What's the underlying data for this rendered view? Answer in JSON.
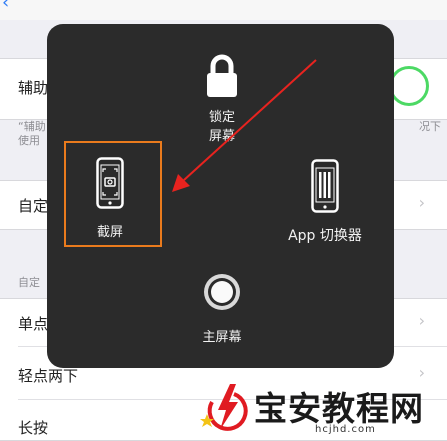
{
  "background": {
    "row_assist": "辅助",
    "note_left_1": "“辅助",
    "note_left_2": "使用",
    "note_right": "况下",
    "row_custom": "自定",
    "section_custom": "自定",
    "row_single_tap": "单点",
    "row_double_tap": "轻点两下",
    "row_long_press": "长按"
  },
  "menu": {
    "lock_label_1": "锁定",
    "lock_label_2": "屏幕",
    "screenshot_label": "截屏",
    "app_switcher_label": "App 切换器",
    "home_label": "主屏幕"
  },
  "annotation": {
    "highlight_color": "#ea7b1d",
    "arrow_color": "#e8231f"
  },
  "watermark": {
    "text": "宝安教程网",
    "url": "hcjhd.com"
  }
}
